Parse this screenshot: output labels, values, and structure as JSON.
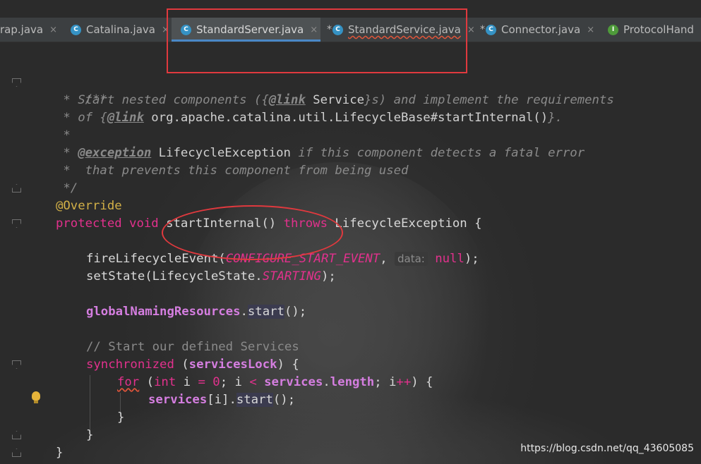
{
  "tabs": [
    {
      "name": "rap.java",
      "modified": false,
      "icon": "class-icon",
      "active": false
    },
    {
      "name": "Catalina.java",
      "modified": false,
      "icon": "class-icon",
      "active": false
    },
    {
      "name": "StandardServer.java",
      "modified": false,
      "icon": "class-icon",
      "active": true
    },
    {
      "name": "StandardService.java",
      "modified": true,
      "icon": "class-icon",
      "active": false
    },
    {
      "name": "Connector.java",
      "modified": true,
      "icon": "class-icon",
      "active": false
    },
    {
      "name": "ProtocolHand",
      "modified": false,
      "icon": "interface-icon",
      "active": false
    }
  ],
  "tab_close_glyph": "×",
  "tab_modified_glyph": "*",
  "class_icon_letter": "C",
  "interface_icon_letter": "I",
  "code": {
    "l1": "/**",
    "l2_a": " * Start nested components ({",
    "l2_tag": "@link",
    "l2_ref": " Service",
    "l2_b": "}s) and implement the requirements",
    "l3_a": " * of {",
    "l3_tag": "@link",
    "l3_ref": " org.apache.catalina.util.LifecycleBase#startInternal()",
    "l3_b": "}.",
    "l4": " *",
    "l5_a": " * ",
    "l5_tag": "@exception",
    "l5_ref": " LifecycleException",
    "l5_b": " if this component detects a fatal error",
    "l6": " *  that prevents this component from being used",
    "l7": " */",
    "l8": "@Override",
    "l9_kw": "protected void ",
    "l9_name": "startInternal",
    "l9_mid": "() ",
    "l9_throws": "throws",
    "l9_end": " LifecycleException {",
    "l11_a": "fireLifecycleEvent(",
    "l11_const": "CONFIGURE_START_EVENT",
    "l11_b": ", ",
    "l11_hint": "data:",
    "l11_null": "null",
    "l11_c": ");",
    "l12_a": "setState(LifecycleState.",
    "l12_const": "STARTING",
    "l12_b": ");",
    "l14_field": "globalNamingResources",
    "l14_b": ".",
    "l14_call": "start",
    "l14_c": "();",
    "l16": "// Start our defined Services",
    "l17_kw": "synchronized",
    "l17_b": " (",
    "l17_field": "servicesLock",
    "l17_c": ") {",
    "l18_for": "for",
    "l18_b": " (",
    "l18_int": "int",
    "l18_c": " i ",
    "l18_eq": "=",
    "l18_d": " ",
    "l18_zero": "0",
    "l18_e": "; i ",
    "l18_lt": "<",
    "l18_f": " ",
    "l18_field": "services",
    "l18_g": ".",
    "l18_len": "length",
    "l18_h": "; i",
    "l18_pp": "++",
    "l18_i": ") {",
    "l19_field": "services",
    "l19_b": "[i].",
    "l19_call": "start",
    "l19_c": "();",
    "l20": "}",
    "l21": "}",
    "l22": "}"
  },
  "watermark": "https://blog.csdn.net/qq_43605085",
  "colors": {
    "annotation": "#e0393e",
    "keyword": "#e2318d",
    "field": "#d57ee0",
    "annotation_tag": "#d2b047",
    "active_tab_underline": "#4a88c7"
  }
}
